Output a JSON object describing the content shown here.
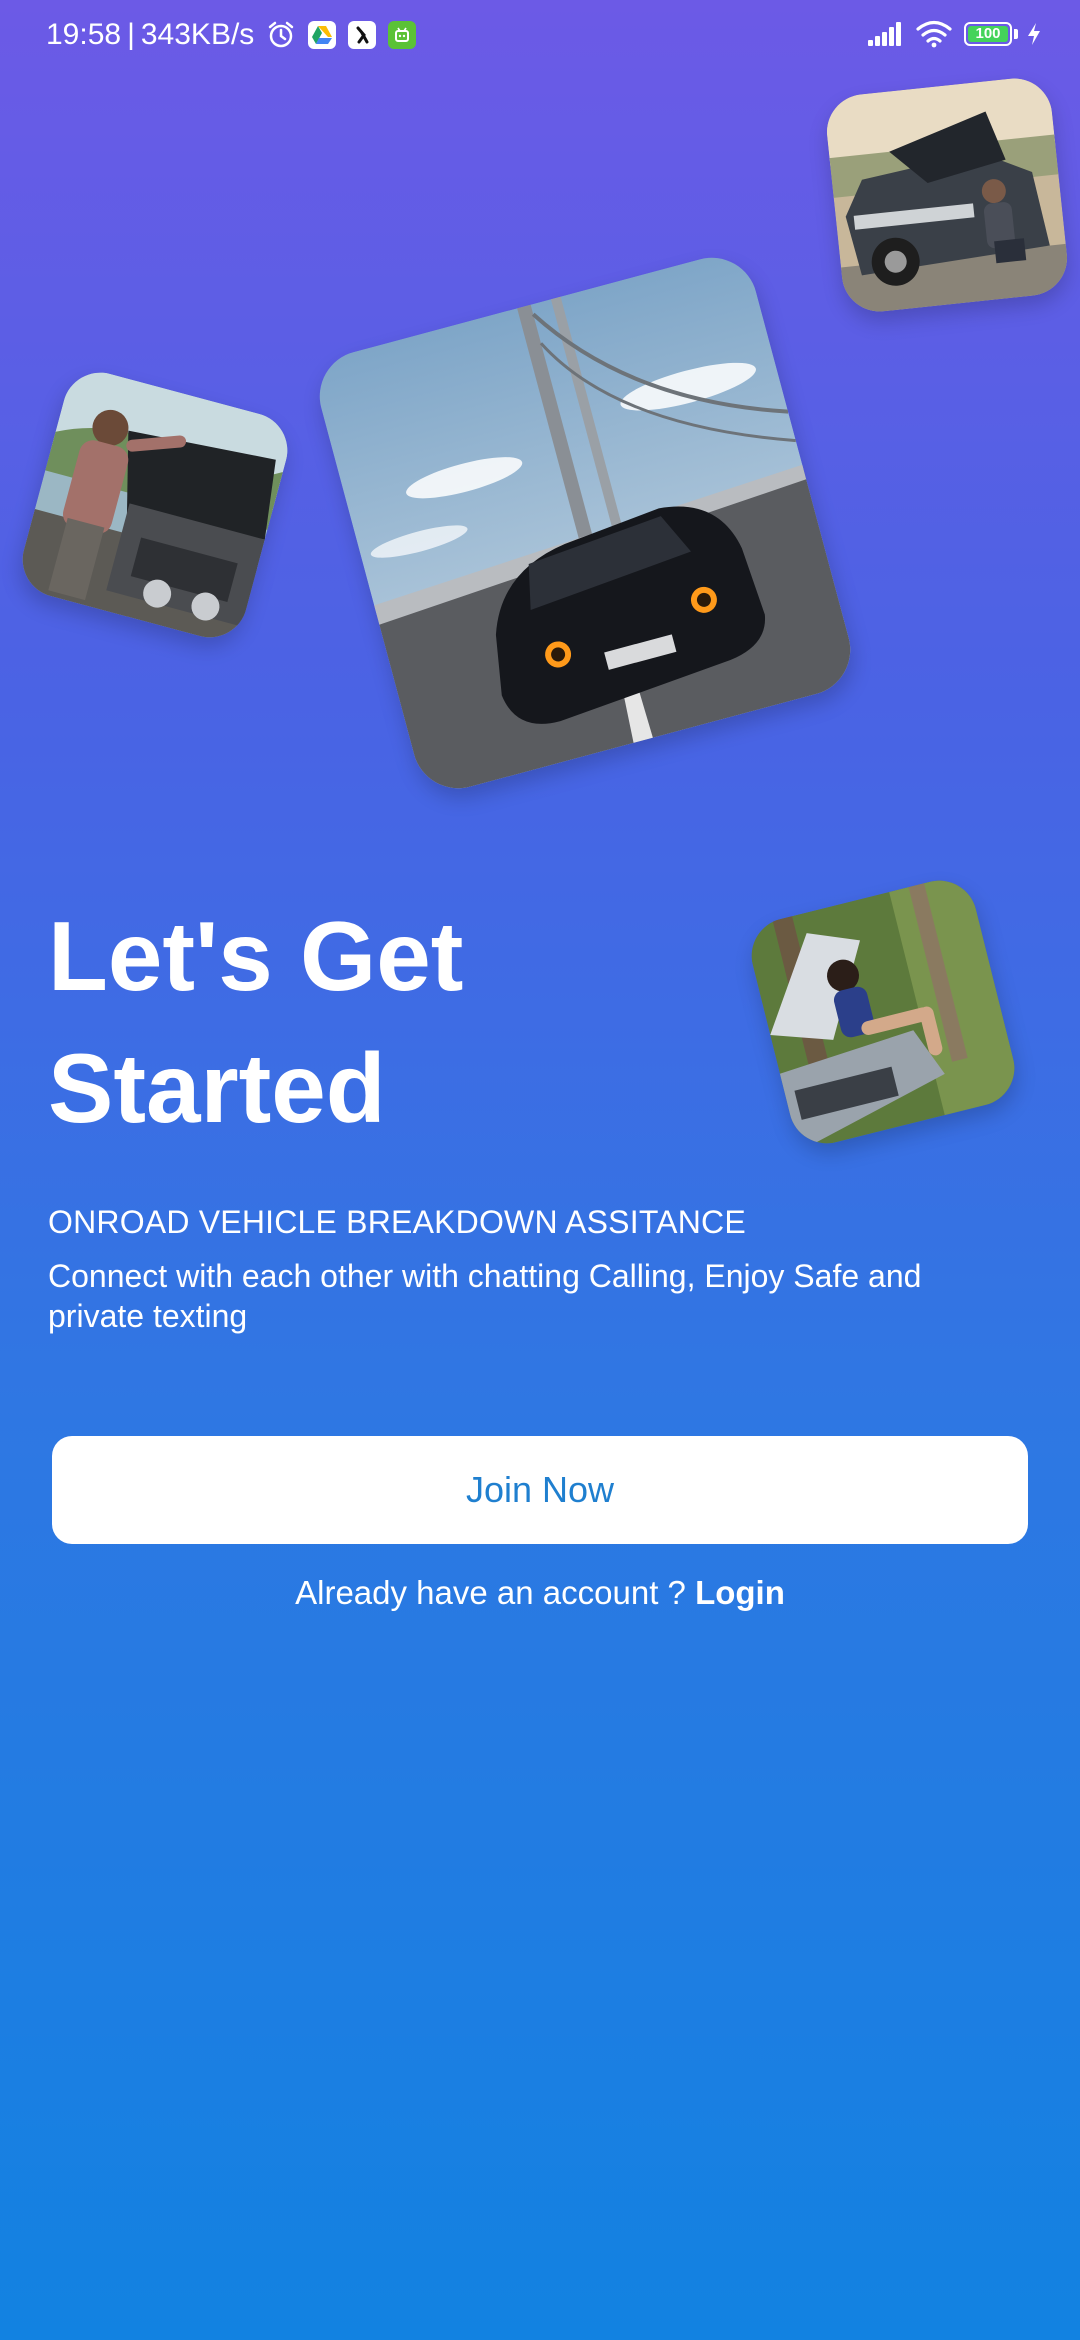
{
  "status_bar": {
    "time": "19:58",
    "separator": "|",
    "net_speed": "343KB/s",
    "battery_percent": "100",
    "battery_level": 1.0,
    "icons": [
      "alarm-icon",
      "google-drive-icon",
      "app-icon",
      "android-icon",
      "signal-icon",
      "wifi-icon",
      "battery-icon",
      "charging-icon"
    ]
  },
  "photos": [
    {
      "name": "car-on-bridge-photo",
      "subject": "black muscle car on suspension bridge"
    },
    {
      "name": "man-checking-engine-photo",
      "subject": "man leaning into open car hood"
    },
    {
      "name": "woman-by-suv-photo",
      "subject": "woman sitting by broken-down SUV"
    },
    {
      "name": "woman-on-car-hood-photo",
      "subject": "woman on phone sitting on car with open hood"
    }
  ],
  "main": {
    "headline_line1": "Let's Get",
    "headline_line2": "Started",
    "tagline": "ONROAD VEHICLE BREAKDOWN ASSITANCE",
    "description": "Connect with each other with chatting Calling, Enjoy Safe and private texting",
    "join_button": "Join Now",
    "login_prompt": "Already have an account ?",
    "login_link": "Login"
  },
  "colors": {
    "gradient_top": "#6c5ae6",
    "gradient_bottom": "#1282e1",
    "button_text": "#1f7fcf",
    "battery_green": "#44d35a"
  }
}
